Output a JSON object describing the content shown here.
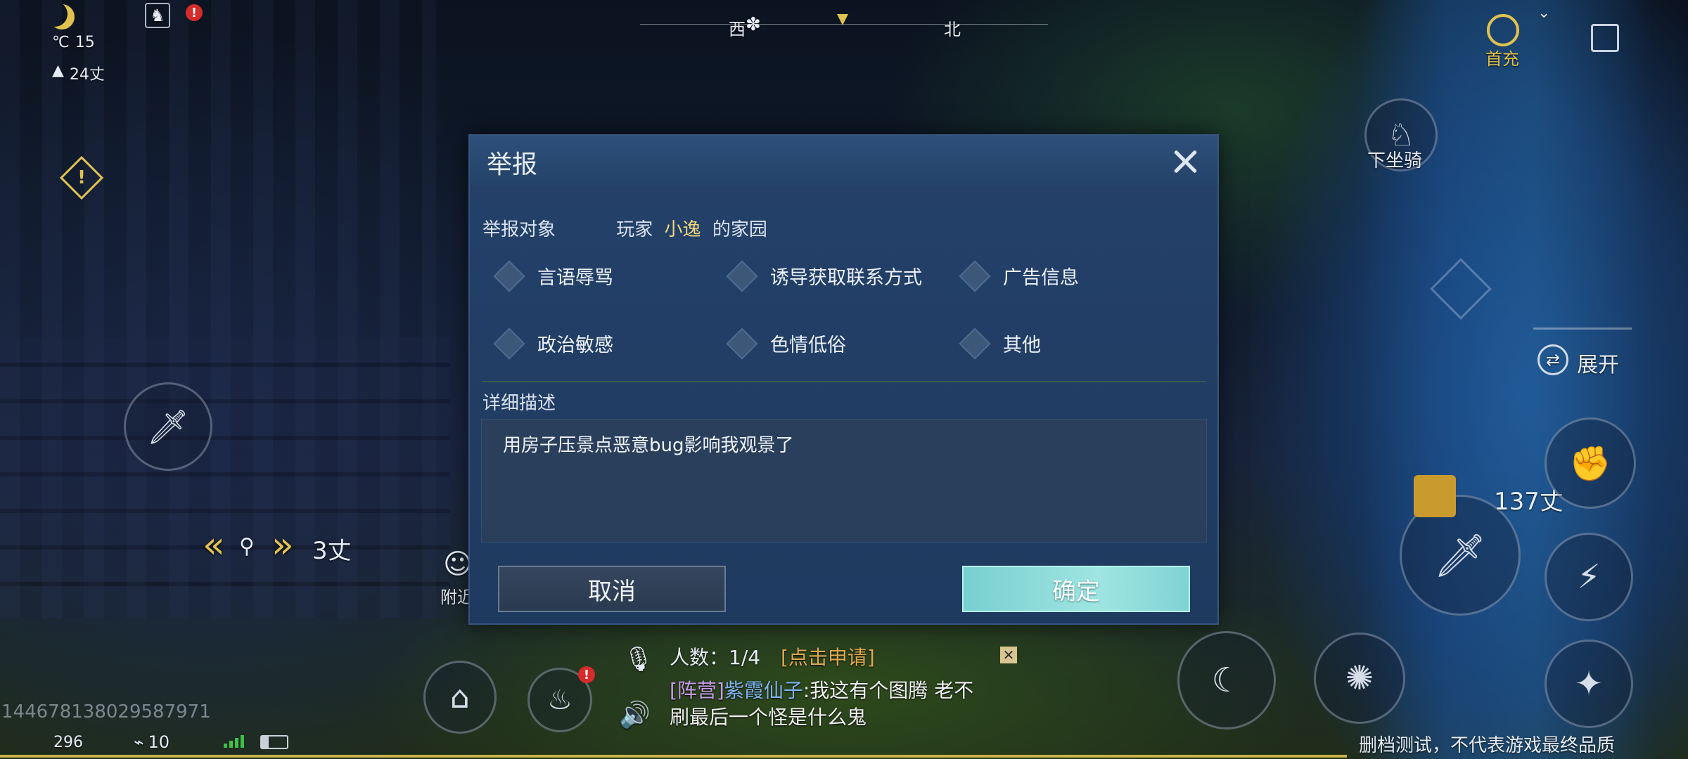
{
  "hud": {
    "temperature": "15",
    "temp_unit": "℃",
    "altitude": "24丈",
    "compass_west": "西",
    "compass_north": "北",
    "first_recharge": "首充",
    "dismount": "下坐骑",
    "expand": "展开",
    "target_distance": "137丈",
    "waypoint_distance": "3丈",
    "nearby": "附近",
    "user_id": "144678138029587971",
    "fps": "296",
    "ping": "10",
    "footer_notice": "删档测试，不代表游戏最终品质"
  },
  "team": {
    "count_label": "人数：1/4",
    "apply_link": "[点击申请]"
  },
  "chat": {
    "channel": "[阵营]",
    "sender": "紫霞仙子",
    "message_line1": ":我这有个图腾 老不",
    "message_line2": "刷最后一个怪是什么鬼"
  },
  "report_dialog": {
    "title": "举报",
    "target_label": "举报对象",
    "target_prefix": "玩家",
    "target_name": "小逸",
    "target_suffix": "的家园",
    "options": [
      "言语辱骂",
      "诱导获取联系方式",
      "广告信息",
      "政治敏感",
      "色情低俗",
      "其他"
    ],
    "description_label": "详细描述",
    "description_text": "用房子压景点恶意bug影响我观景了",
    "cancel_label": "取消",
    "confirm_label": "确定"
  },
  "colors": {
    "accent_gold": "#e1c250",
    "player_name": "#f2d77a",
    "confirm_bg": "#8fdcda",
    "chat_channel": "#c89bea",
    "chat_sender": "#7fb4f0",
    "apply_link": "#e0a850"
  },
  "icons": [
    "moon-icon",
    "thermometer-icon",
    "mountain-icon",
    "boot-icon",
    "warning-icon",
    "sword-icon",
    "compass-icon",
    "horse-icon",
    "camera-icon",
    "home-icon",
    "bag-icon",
    "mic-icon",
    "speaker-icon",
    "signal-icon",
    "battery-icon"
  ]
}
